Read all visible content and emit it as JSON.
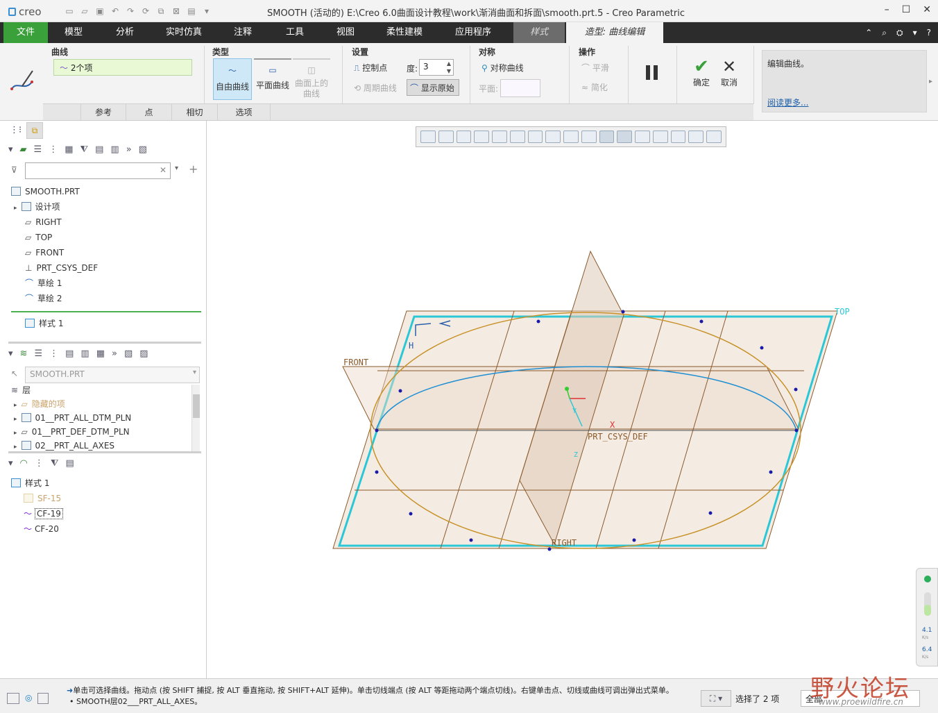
{
  "titlebar": {
    "app": "creo",
    "title": "SMOOTH (活动的) E:\\Creo 6.0曲面设计教程\\work\\渐消曲面和拆面\\smooth.prt.5 - Creo Parametric"
  },
  "menu": {
    "file": "文件",
    "items": [
      "模型",
      "分析",
      "实时仿真",
      "注释",
      "工具",
      "视图",
      "柔性建模",
      "应用程序"
    ],
    "style_tab": "样式",
    "active_tab": "造型: 曲线编辑"
  },
  "ribbon": {
    "curve_group": {
      "title": "曲线",
      "collector": "2个项"
    },
    "type_group": {
      "title": "类型",
      "free": "自由曲线",
      "planar": "平面曲线",
      "cos_line1": "曲面上的",
      "cos_line2": "曲线"
    },
    "settings_group": {
      "title": "设置",
      "control_points": "控制点",
      "degree_label": "度:",
      "degree_value": "3",
      "periodic": "周期曲线",
      "show_original": "显示原始"
    },
    "symmetry_group": {
      "title": "对称",
      "sym_curve": "对称曲线",
      "plane_label": "平面:"
    },
    "ops_group": {
      "title": "操作",
      "smooth": "平滑",
      "simplify": "简化"
    },
    "ok": "确定",
    "cancel": "取消",
    "help_text": "编辑曲线。",
    "help_link": "阅读更多..."
  },
  "subtabs": [
    "参考",
    "点",
    "相切",
    "选项"
  ],
  "model_tree": {
    "root": "SMOOTH.PRT",
    "items": [
      "设计项",
      "RIGHT",
      "TOP",
      "FRONT",
      "PRT_CSYS_DEF",
      "草绘 1",
      "草绘 2"
    ],
    "after_insert": "样式 1"
  },
  "layer_tree": {
    "combo": "SMOOTH.PRT",
    "root": "层",
    "items": [
      "隐藏的项",
      "01__PRT_ALL_DTM_PLN",
      "01__PRT_DEF_DTM_PLN",
      "02__PRT_ALL_AXES"
    ]
  },
  "style_tree": {
    "root": "样式 1",
    "items": [
      "SF-15",
      "CF-19",
      "CF-20"
    ]
  },
  "viewport_labels": {
    "top": "TOP",
    "front": "FRONT",
    "right": "RIGHT",
    "csys": "PRT_CSYS_DEF",
    "axis_x": "X",
    "axis_y": "Y",
    "axis_z": "Z",
    "h_mark": "H"
  },
  "status": {
    "line1": "单击可选择曲线。拖动点 (按 SHIFT 捕捉, 按 ALT 垂直拖动, 按 SHIFT+ALT 延伸)。单击切线端点 (按 ALT 等距拖动两个端点切线)。右键单击点、切线或曲线可调出弹出式菜单。",
    "line2": "SMOOTH层02___PRT_ALL_AXES。",
    "selected": "选择了 2 项",
    "filter": "全部"
  },
  "side_indicator": {
    "up": "4.1",
    "down": "6.4",
    "unit": "K/s"
  },
  "watermark": {
    "cn": "野火论坛",
    "url": "www.proewildfire.cn"
  },
  "colors": {
    "accent_green": "#3aa13a",
    "menubar": "#2c2c2c",
    "plane_cyan": "#2bc7d6",
    "plane_fill": "#f0e5da",
    "plane_edge": "#8b5a2b"
  }
}
